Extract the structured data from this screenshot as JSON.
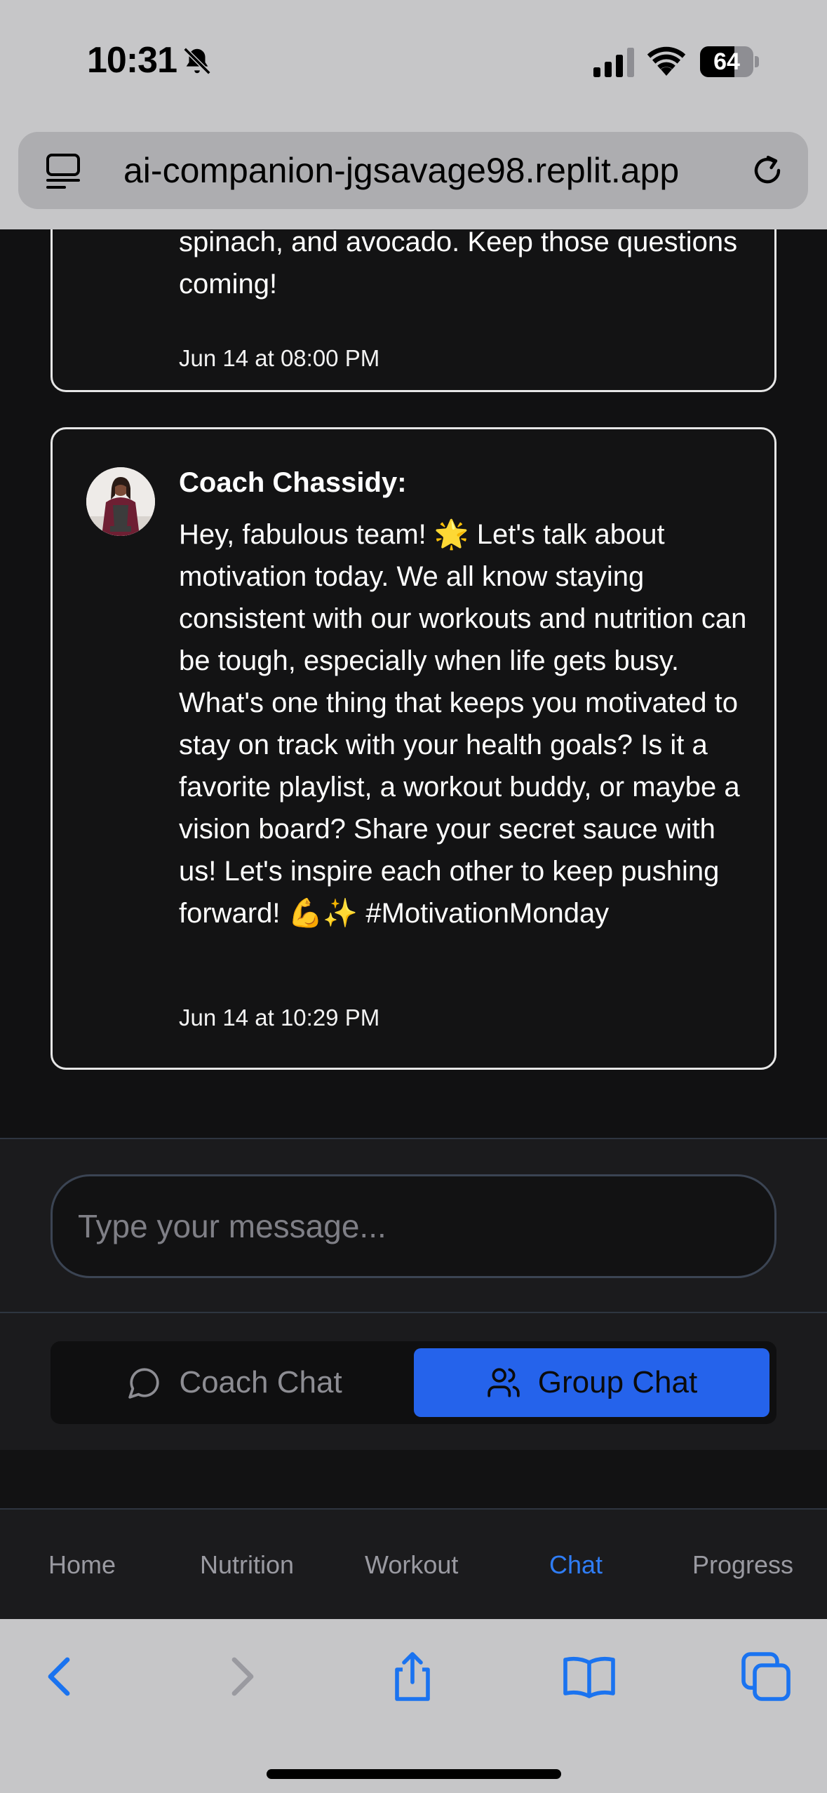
{
  "status_bar": {
    "time": "10:31",
    "battery_percent": "64",
    "battery_level": 0.64,
    "icons": [
      "bell-slash-icon",
      "cellular-signal-icon",
      "wifi-icon",
      "battery-icon"
    ]
  },
  "browser": {
    "url": "ai-companion-jgsavage98.replit.app",
    "left_icon": "reader-view-icon",
    "right_icon": "reload-icon",
    "toolbar_icons": [
      "back-icon",
      "forward-icon",
      "share-icon",
      "bookmarks-icon",
      "tabs-icon"
    ]
  },
  "messages": [
    {
      "text": "spinach, and avocado. Keep those questions coming!",
      "timestamp": "Jun 14 at 08:00 PM"
    },
    {
      "sender": "Coach Chassidy:",
      "text": "Hey, fabulous team! 🌟 Let's talk about motivation today. We all know staying consistent with our workouts and nutrition can be tough, especially when life gets busy. What's one thing that keeps you motivated to stay on track with your health goals? Is it a favorite playlist, a workout buddy, or maybe a vision board? Share your secret sauce with us! Let's inspire each other to keep pushing forward! 💪✨ #MotivationMonday",
      "timestamp": "Jun 14 at 10:29 PM"
    }
  ],
  "composer": {
    "placeholder": "Type your message..."
  },
  "chat_toggle": {
    "coach_label": "Coach Chat",
    "group_label": "Group Chat",
    "active": "Group Chat"
  },
  "bottom_nav": {
    "items": [
      "Home",
      "Nutrition",
      "Workout",
      "Chat",
      "Progress"
    ],
    "active": "Chat"
  },
  "colors": {
    "accent": "#2563eb",
    "nav_active": "#2f7df6",
    "safari_blue": "#1a73f0"
  }
}
